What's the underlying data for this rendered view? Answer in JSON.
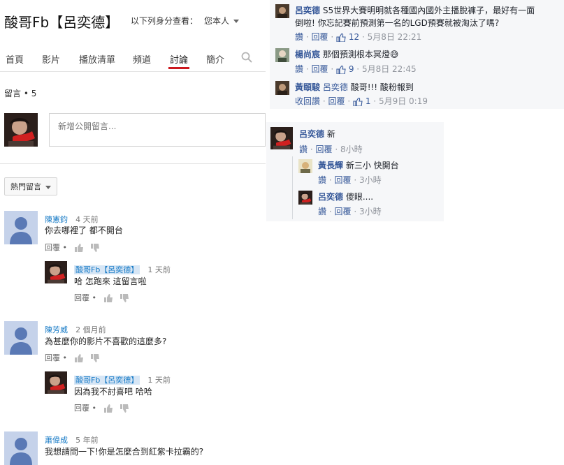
{
  "youtube": {
    "channel_title": "酸哥Fb【呂奕德】",
    "view_as_label": "以下列身分查看：",
    "view_as_value": "您本人",
    "tabs": [
      {
        "label": "首頁"
      },
      {
        "label": "影片"
      },
      {
        "label": "播放清單"
      },
      {
        "label": "頻道"
      },
      {
        "label": "討論",
        "active": true
      },
      {
        "label": "簡介"
      }
    ],
    "comment_count": "留言 • 5",
    "new_comment_placeholder": "新增公開留言...",
    "sort_label": "熱門留言",
    "reply_label": "回覆 •",
    "comments": [
      {
        "author": "陳憲鈞",
        "time": "4 天前",
        "text": "你去哪裡了  都不開台",
        "reply": {
          "author": "酸哥Fb【呂奕德】",
          "time": "1 天前",
          "text": "哈 怎跑來 這留言啦"
        }
      },
      {
        "author": "陳芳威",
        "time": "2 個月前",
        "text": "為甚麼你的影片不喜歡的這麼多?",
        "reply": {
          "author": "酸哥Fb【呂奕德】",
          "time": "1 天前",
          "text": "因為我不討喜吧 哈哈"
        }
      },
      {
        "author": "蕭偉成",
        "time": "5 年前",
        "text": "我想請問一下!你是怎麼合到紅紫卡拉霸的?"
      }
    ]
  },
  "facebook_top": {
    "comments": [
      {
        "name": "呂奕德",
        "text_line1": "S5世界大賽明明就各種國內國外主播脫褲子，最好有一面",
        "text_line2": "倒啦! 你忘記賽前預測第一名的LGD預賽就被淘汰了嗎?",
        "like": "讚",
        "reply": "回覆",
        "likes": "12",
        "time": "5月8日 22:21"
      },
      {
        "name": "楊尚宸",
        "text": "那個預測根本冥燈😅",
        "like": "讚",
        "reply": "回覆",
        "likes": "9",
        "time": "5月8日 22:45"
      },
      {
        "name": "黃頤駿",
        "tag": "呂奕德",
        "text": "酸哥!!! 酸粉報到",
        "like": "收回讚",
        "reply": "回覆",
        "likes": "1",
        "time": "5月9日 0:19"
      }
    ]
  },
  "facebook_bottom": {
    "main": {
      "name": "呂奕德",
      "text": "新",
      "like": "讚",
      "reply": "回覆",
      "time": "8小時"
    },
    "replies": [
      {
        "name": "黃長輝",
        "text": "新三小 快開台",
        "like": "讚",
        "reply": "回覆",
        "time": "3小時"
      },
      {
        "name": "呂奕德",
        "text": "傻眼....",
        "like": "讚",
        "reply": "回覆",
        "time": "3小時"
      }
    ]
  },
  "colors": {
    "youtube_red": "#cc181e",
    "youtube_link": "#167ac6",
    "fb_link": "#365899",
    "fb_bg": "#f6f7f9"
  }
}
